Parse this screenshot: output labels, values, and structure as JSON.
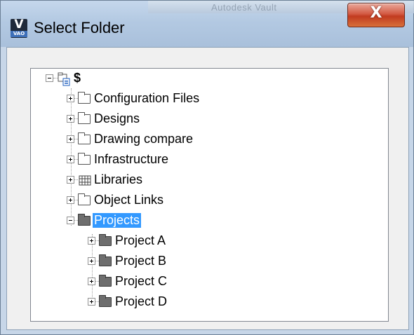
{
  "window": {
    "title": "Select Folder",
    "close_label": "X",
    "background_app_caption": "Autodesk Vault"
  },
  "tree": {
    "root": {
      "label": "$",
      "expanded": true
    },
    "items": [
      {
        "label": "Configuration Files",
        "icon": "folder-icon",
        "expanded": false
      },
      {
        "label": "Designs",
        "icon": "folder-icon",
        "expanded": false
      },
      {
        "label": "Drawing compare",
        "icon": "folder-icon",
        "expanded": false
      },
      {
        "label": "Infrastructure",
        "icon": "folder-icon",
        "expanded": false
      },
      {
        "label": "Libraries",
        "icon": "library-icon",
        "expanded": false
      },
      {
        "label": "Object Links",
        "icon": "folder-icon",
        "expanded": false
      },
      {
        "label": "Projects",
        "icon": "folder-icon",
        "expanded": true,
        "selected": true
      }
    ],
    "project_children": [
      {
        "label": "Project A",
        "icon": "folder-icon",
        "expanded": false
      },
      {
        "label": "Project B",
        "icon": "folder-icon",
        "expanded": false
      },
      {
        "label": "Project C",
        "icon": "folder-icon",
        "expanded": false
      },
      {
        "label": "Project D",
        "icon": "folder-icon",
        "expanded": false
      }
    ]
  },
  "colors": {
    "selection": "#3399ff",
    "close_button": "#c13b20",
    "titlebar": "#b3c9e2"
  }
}
